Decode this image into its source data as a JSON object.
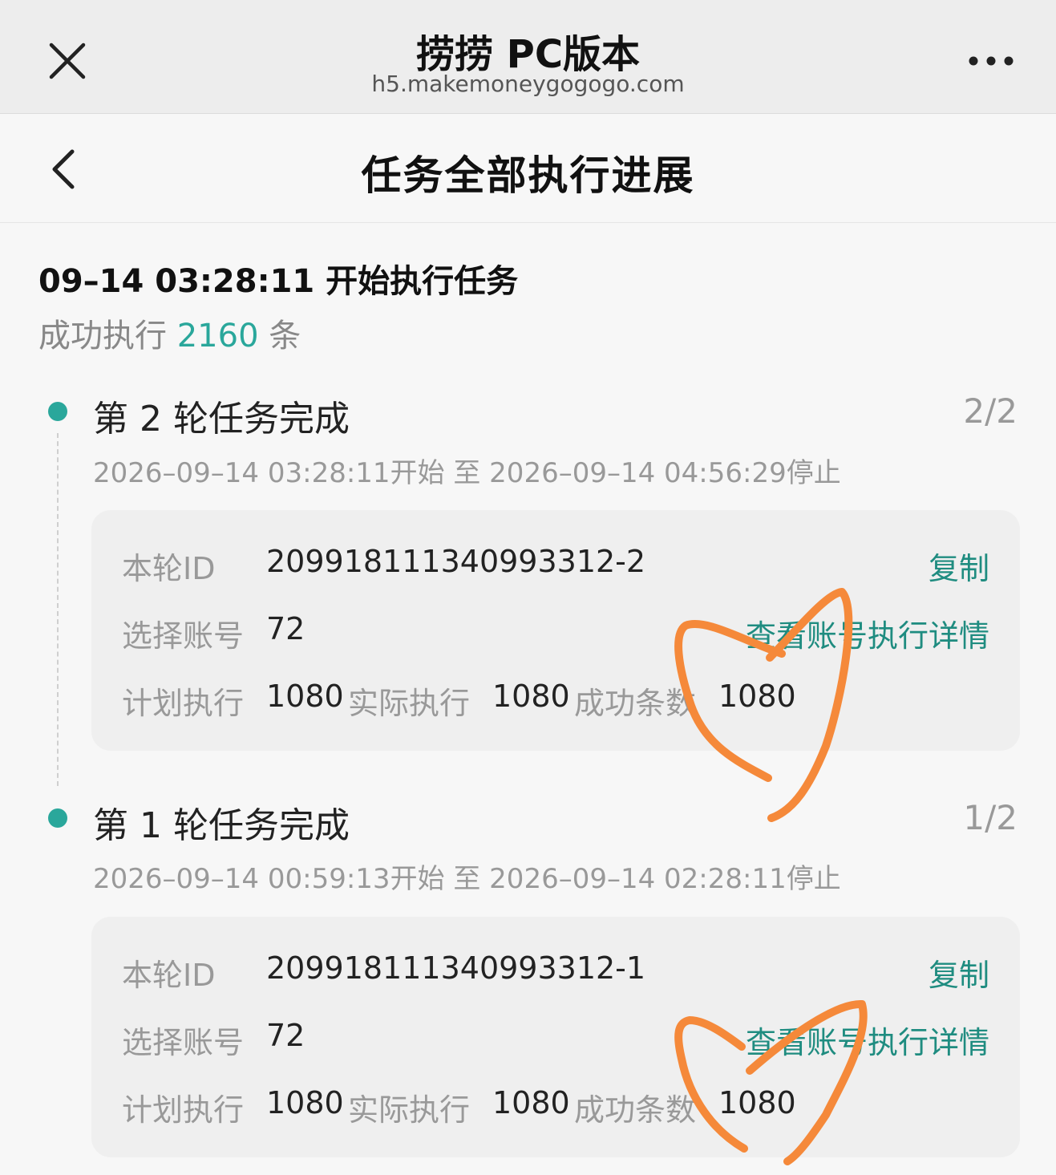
{
  "browser": {
    "title": "捞捞 PC版本",
    "url": "h5.makemoneygogogo.com",
    "icons": {
      "close": "close-icon",
      "more": "more-dots-icon"
    }
  },
  "header": {
    "title": "任务全部执行进展",
    "back_icon": "chevron-left-icon"
  },
  "summary": {
    "title": "09–14 03:28:11 开始执行任务",
    "success_prefix": "成功执行",
    "success_count": "2160",
    "success_suffix": "条"
  },
  "labels": {
    "round_id": "本轮ID",
    "accounts": "选择账号",
    "planned": "计划执行",
    "actual": "实际执行",
    "success": "成功条数",
    "copy": "复制",
    "view_details": "查看账号执行详情"
  },
  "rounds": [
    {
      "title": "第 2 轮任务完成",
      "progress": "2/2",
      "time": "2026–09–14 03:28:11开始 至 2026–09–14 04:56:29停止",
      "id": "209918111340993312-2",
      "accounts": "72",
      "planned": "1080",
      "actual": "1080",
      "success": "1080"
    },
    {
      "title": "第 1 轮任务完成",
      "progress": "1/2",
      "time": "2026–09–14 00:59:13开始 至 2026–09–14 02:28:11停止",
      "id": "209918111340993312-1",
      "accounts": "72",
      "planned": "1080",
      "actual": "1080",
      "success": "1080"
    }
  ],
  "colors": {
    "accent": "#2aa79b",
    "link": "#1f8c80",
    "scribble": "#f5893a"
  }
}
